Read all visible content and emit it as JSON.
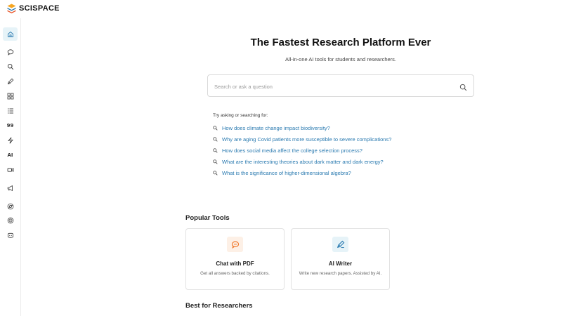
{
  "app": {
    "logo_text": "SCISPACE"
  },
  "sidebar": {
    "items": [
      {
        "name": "home",
        "icon": "home-icon"
      },
      {
        "name": "chat",
        "icon": "chat-bubble-icon"
      },
      {
        "name": "search",
        "icon": "search-icon"
      },
      {
        "name": "writer",
        "icon": "pen-icon"
      },
      {
        "name": "apps",
        "icon": "grid-icon"
      },
      {
        "name": "list",
        "icon": "list-icon"
      },
      {
        "name": "citation",
        "icon": "quote-icon",
        "text": "99"
      },
      {
        "name": "flash",
        "icon": "lightning-icon"
      },
      {
        "name": "ai",
        "icon": "ai-icon",
        "text": "AI"
      },
      {
        "name": "video",
        "icon": "video-icon"
      },
      {
        "name": "announce",
        "icon": "megaphone-icon"
      },
      {
        "name": "chrome",
        "icon": "chrome-icon"
      },
      {
        "name": "openai",
        "icon": "openai-icon"
      },
      {
        "name": "discord",
        "icon": "discord-icon"
      }
    ]
  },
  "hero": {
    "title": "The Fastest Research Platform Ever",
    "subtitle": "All-in-one AI tools for students and researchers."
  },
  "search": {
    "placeholder": "Search or ask a question",
    "value": ""
  },
  "suggestions": {
    "label": "Try asking or searching for:",
    "items": [
      "How does climate change impact biodiversity?",
      "Why are aging Covid patients more susceptible to severe complications?",
      "How does social media affect the college selection process?",
      "What are the interesting theories about dark matter and dark energy?",
      "What is the significance of higher-dimensional algebra?"
    ]
  },
  "popular_tools": {
    "title": "Popular Tools",
    "tools": [
      {
        "name": "Chat with PDF",
        "description": "Get all answers backed by citations.",
        "icon": "chat-pdf-icon",
        "accent": "#f07a2e"
      },
      {
        "name": "AI Writer",
        "description": "Write new research papers. Assisted by AI.",
        "icon": "pen-nib-icon",
        "accent": "#2a7ab0"
      }
    ]
  },
  "best_for": {
    "title": "Best for Researchers"
  },
  "colors": {
    "accent": "#2a7ab0",
    "link": "#2a7ab0",
    "active_bg": "#e6f3f8"
  }
}
